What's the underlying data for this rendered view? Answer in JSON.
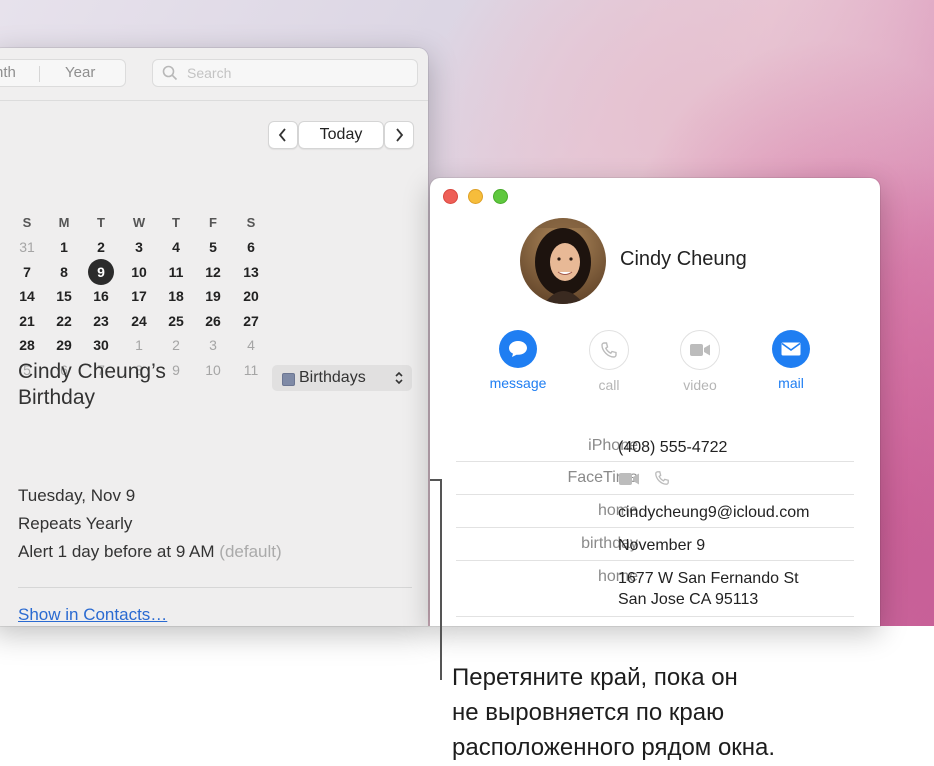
{
  "calendar": {
    "toolbar": {
      "month_partial": "nth",
      "year": "Year",
      "search_placeholder": "Search"
    },
    "nav": {
      "today": "Today"
    },
    "weekdays": [
      "S",
      "M",
      "T",
      "W",
      "T",
      "F",
      "S"
    ],
    "weeks": [
      [
        "31",
        "1",
        "2",
        "3",
        "4",
        "5",
        "6"
      ],
      [
        "7",
        "8",
        "9",
        "10",
        "11",
        "12",
        "13"
      ],
      [
        "14",
        "15",
        "16",
        "17",
        "18",
        "19",
        "20"
      ],
      [
        "21",
        "22",
        "23",
        "24",
        "25",
        "26",
        "27"
      ],
      [
        "28",
        "29",
        "30",
        "1",
        "2",
        "3",
        "4"
      ],
      [
        "5",
        "6",
        "7",
        "8",
        "9",
        "10",
        "11"
      ]
    ],
    "selected_day": "9",
    "event": {
      "title": "Cindy Cheung’s Birthday",
      "calendar_name": "Birthdays",
      "calendar_color": "#7f8aa6",
      "date": "Tuesday, Nov 9",
      "repeat": "Repeats Yearly",
      "alert": "Alert 1 day before at 9 AM",
      "alert_note": "(default)",
      "link": "Show in Contacts…"
    }
  },
  "contact": {
    "name": "Cindy Cheung",
    "actions": [
      {
        "label": "message",
        "icon": "message-icon",
        "enabled": true
      },
      {
        "label": "call",
        "icon": "phone-icon",
        "enabled": false
      },
      {
        "label": "video",
        "icon": "video-icon",
        "enabled": false
      },
      {
        "label": "mail",
        "icon": "mail-icon",
        "enabled": true
      }
    ],
    "rows": [
      {
        "key": "iPhone",
        "value": "(408) 555-4722"
      },
      {
        "key": "FaceTime",
        "value": ""
      },
      {
        "key": "home",
        "value": "cindycheung9@icloud.com"
      },
      {
        "key": "birthday",
        "value": "November 9"
      },
      {
        "key": "home",
        "value": "1677 W San Fernando St",
        "value2": "San Jose CA 95113"
      }
    ],
    "accent": "#1f7ef2"
  },
  "caption": {
    "line1": "Перетяните край, пока он",
    "line2": "не выровняется по краю",
    "line3": "расположенного рядом окна."
  }
}
